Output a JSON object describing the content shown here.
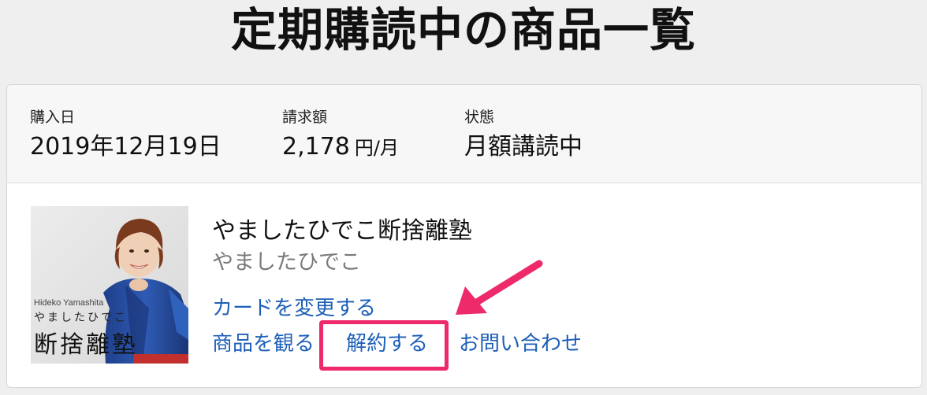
{
  "page": {
    "title": "定期購読中の商品一覧"
  },
  "summary": {
    "purchase_date_label": "購入日",
    "purchase_date": "2019年12月19日",
    "billing_label": "請求額",
    "billing_amount": "2,178",
    "billing_unit": "円/月",
    "status_label": "状態",
    "status": "月額講読中"
  },
  "product": {
    "title": "やましたひでこ断捨離塾",
    "author": "やましたひでこ",
    "image_text": {
      "romaji": "Hideko Yamashita",
      "kana": "やましたひでこ",
      "name": "断捨離塾"
    },
    "links": {
      "change_card": "カードを変更する",
      "view": "商品を観る",
      "cancel": "解約する",
      "contact": "お問い合わせ"
    }
  },
  "colors": {
    "link": "#1d5fb8",
    "highlight": "#ee2a6a",
    "background": "#efefef"
  }
}
